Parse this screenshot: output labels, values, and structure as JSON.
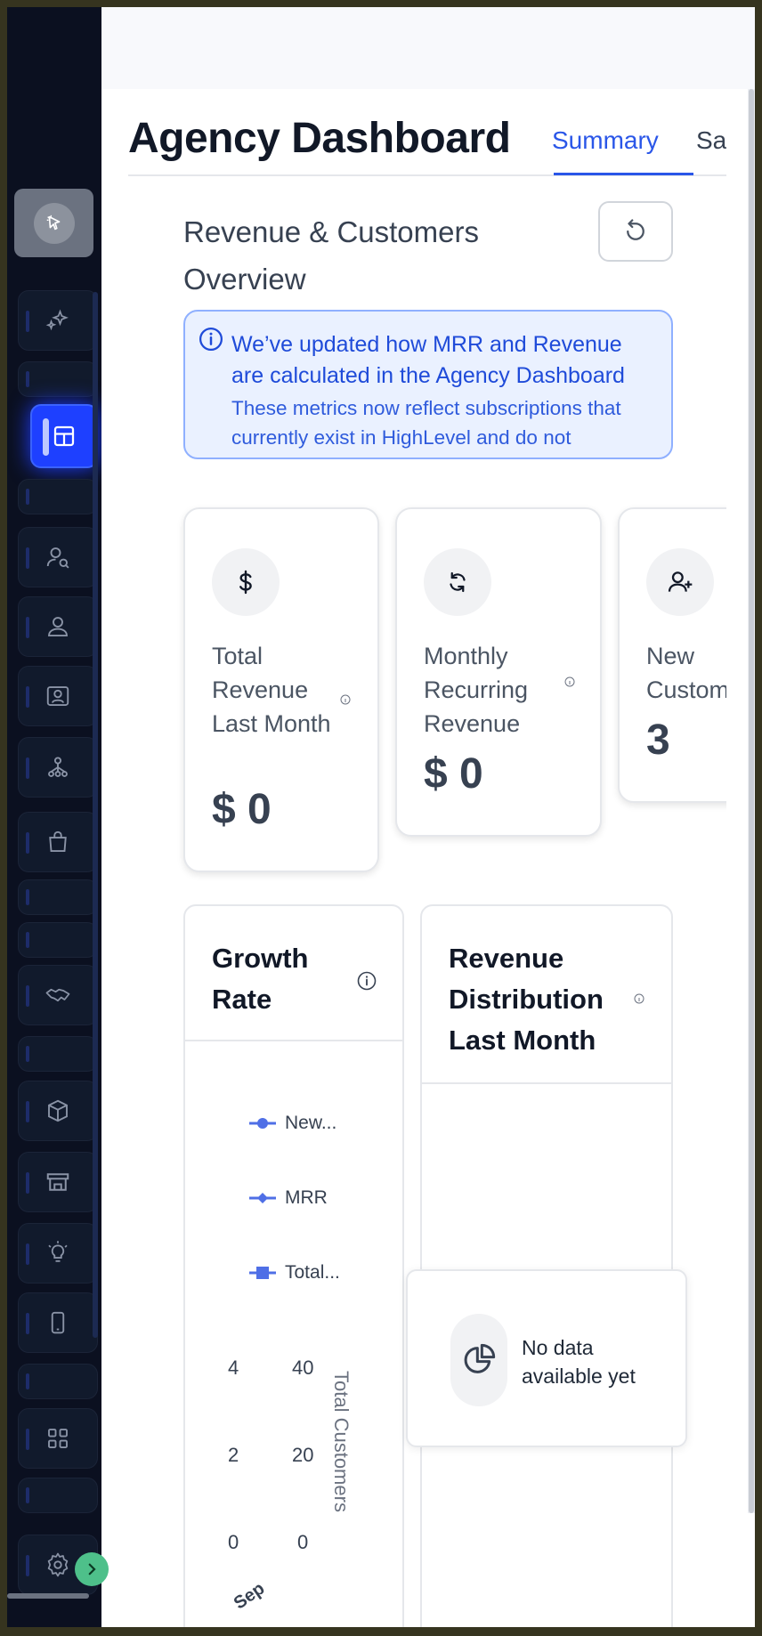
{
  "page": {
    "title": "Agency Dashboard"
  },
  "tabs": [
    {
      "label": "Summary",
      "active": true
    },
    {
      "label": "Sales",
      "active": false
    }
  ],
  "section": {
    "title": "Revenue & Customers Overview"
  },
  "alert": {
    "heading": "We’ve updated how MRR and Revenue are calculated in the Agency Dashboard",
    "body": "These metrics now reflect subscriptions that currently exist in HighLevel and do not"
  },
  "metrics": [
    {
      "label": "Total Revenue Last Month",
      "value": "$ 0",
      "icon": "dollar-icon"
    },
    {
      "label": "Monthly Recurring Revenue",
      "value": "$ 0",
      "icon": "refresh-cycle-icon"
    },
    {
      "label": "New Customers",
      "value": "3",
      "icon": "user-plus-icon"
    }
  ],
  "growth_rate": {
    "title": "Growth Rate",
    "legend": [
      "New...",
      "MRR",
      "Total..."
    ],
    "left_axis_ticks": [
      "4",
      "2",
      "0"
    ],
    "right_axis_ticks": [
      "40",
      "20",
      "0"
    ],
    "right_axis_label": "Total Customers",
    "x_tick": "Sep"
  },
  "revenue_distribution": {
    "title": "Revenue Distribution Last Month",
    "empty_text": "No data available yet"
  },
  "colors": {
    "accent": "#2a56e8",
    "sidebar_bg": "#0b1020",
    "series": "#4f6fe6"
  }
}
